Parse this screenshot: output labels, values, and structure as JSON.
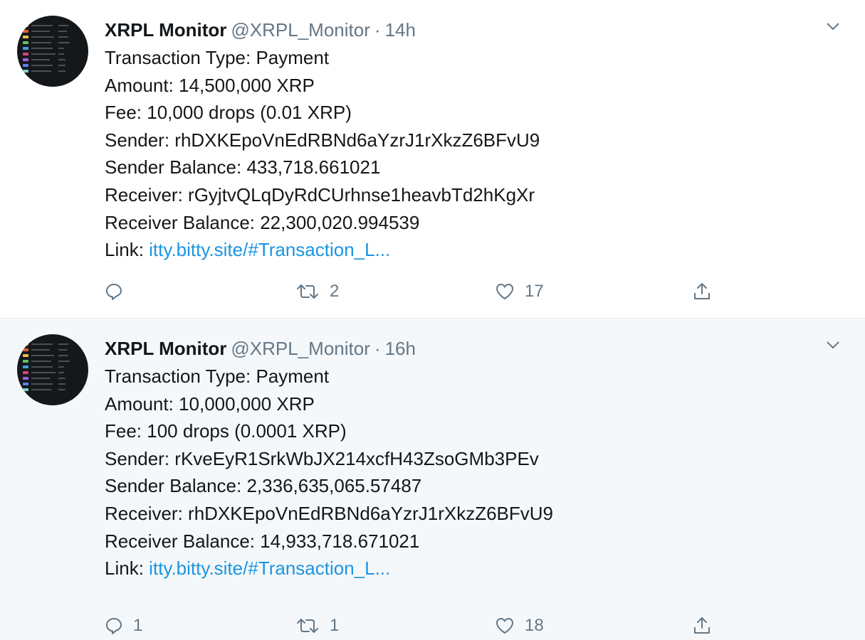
{
  "colors": {
    "link": "#1b95e0",
    "secondary_text": "#657786",
    "primary_text": "#14171a",
    "highlight_background": "#f5f8fa"
  },
  "tweets": [
    {
      "display_name": "XRPL Monitor",
      "handle": "@XRPL_Monitor",
      "separator": "·",
      "time": "14h",
      "lines": [
        "Transaction Type: Payment",
        "Amount: 14,500,000 XRP",
        "Fee: 10,000 drops (0.01 XRP)",
        "Sender: rhDXKEpoVnEdRBNd6aYzrJ1rXkzZ6BFvU9",
        "Sender Balance: 433,718.661021",
        "Receiver: rGyjtvQLqDyRdCUrhnse1heavbTd2hKgXr",
        "Receiver Balance: 22,300,020.994539"
      ],
      "link_label": "Link: ",
      "link_text": "itty.bitty.site/#Transaction_L...",
      "reply_count": "",
      "retweet_count": "2",
      "like_count": "17",
      "icons": [
        "caret-down-icon",
        "reply-icon",
        "retweet-icon",
        "like-icon",
        "share-icon"
      ]
    },
    {
      "display_name": "XRPL Monitor",
      "handle": "@XRPL_Monitor",
      "separator": "·",
      "time": "16h",
      "lines": [
        "Transaction Type: Payment",
        "Amount: 10,000,000 XRP",
        "Fee: 100 drops (0.0001 XRP)",
        "Sender: rKveEyR1SrkWbJX214xcfH43ZsoGMb3PEv",
        "Sender Balance: 2,336,635,065.57487",
        "Receiver: rhDXKEpoVnEdRBNd6aYzrJ1rXkzZ6BFvU9",
        "Receiver Balance: 14,933,718.671021"
      ],
      "link_label": "Link: ",
      "link_text": "itty.bitty.site/#Transaction_L...",
      "reply_count": "1",
      "retweet_count": "1",
      "like_count": "18",
      "icons": [
        "caret-down-icon",
        "reply-icon",
        "retweet-icon",
        "like-icon",
        "share-icon"
      ]
    }
  ]
}
